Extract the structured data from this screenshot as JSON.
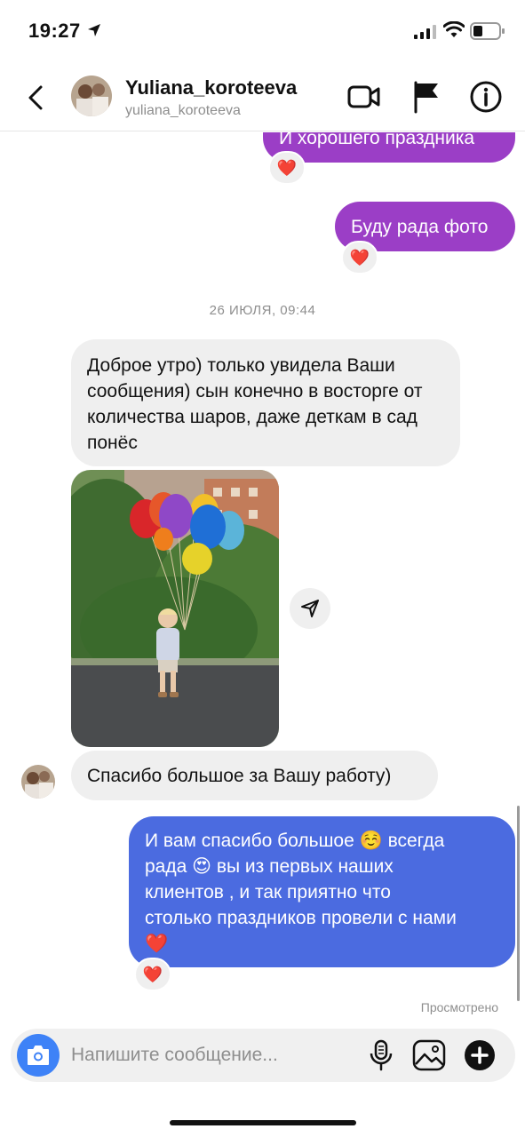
{
  "status_bar": {
    "time": "19:27"
  },
  "header": {
    "name": "Yuliana_koroteeva",
    "username": "yuliana_koroteeva"
  },
  "messages": [
    {
      "side": "out",
      "text": "И хорошего праздника",
      "reaction": "❤️"
    },
    {
      "side": "out",
      "text": "Буду рада фото",
      "reaction": "❤️"
    },
    {
      "type": "date",
      "text": "26 ИЮЛЯ, 09:44"
    },
    {
      "side": "in",
      "text": "Доброе утро) только увидела Ваши сообщения) сын конечно в восторге от количества шаров, даже деткам в сад понёс"
    },
    {
      "side": "in",
      "type": "photo"
    },
    {
      "side": "in",
      "text": "Спасибо большое за Вашу работу)"
    },
    {
      "side": "out",
      "text_lines": [
        "И вам спасибо большое ☺️ всегда",
        "рада 😍 вы из первых наших",
        "клиентов , и так приятно что",
        "столько праздников провели с нами",
        "❤️"
      ],
      "reaction": "❤️"
    }
  ],
  "seen_label": "Просмотрено",
  "composer": {
    "placeholder": "Напишите сообщение..."
  },
  "colors": {
    "outgoing_bubble": "#9b3ec6",
    "outgoing_bubble_latest": "#4b6be0",
    "incoming_bubble": "#efefef",
    "camera_button": "#3e82f7"
  }
}
